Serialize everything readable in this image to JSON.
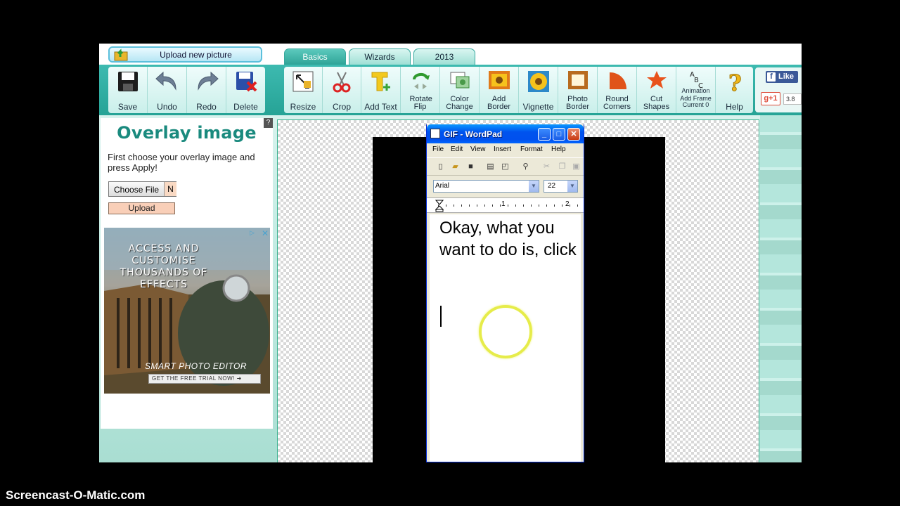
{
  "app": {
    "upload_new_picture": "Upload new picture",
    "tabs": [
      "Basics",
      "Wizards",
      "2013"
    ],
    "edit_tools": [
      "Save",
      "Undo",
      "Redo",
      "Delete"
    ],
    "tools": [
      {
        "label": "Resize",
        "icon": "resize-icon"
      },
      {
        "label": "Crop",
        "icon": "scissors-icon"
      },
      {
        "label": "Add Text",
        "icon": "text-t-icon"
      },
      {
        "label": "Rotate Flip",
        "icon": "rotate-icon"
      },
      {
        "label": "Color Change",
        "icon": "color-change-icon"
      },
      {
        "label": "Add Border",
        "icon": "sunflower-border-icon"
      },
      {
        "label": "Vignette",
        "icon": "sunflower-icon"
      },
      {
        "label": "Photo Border",
        "icon": "frame-icon"
      },
      {
        "label": "Round Corners",
        "icon": "round-corner-icon"
      },
      {
        "label": "Cut Shapes",
        "icon": "star-shape-icon"
      },
      {
        "label": "Animation",
        "icon": "abc-icon",
        "sub1": "Add Frame",
        "sub2": "Current 0"
      },
      {
        "label": "Help",
        "icon": "question-icon"
      }
    ],
    "social": {
      "like": "Like",
      "gplus": "g+1",
      "count": "3.8"
    }
  },
  "panel": {
    "title": "Overlay image",
    "help_mark": "?",
    "instructions": "First choose your overlay image and press Apply!",
    "choose_file": "Choose File",
    "choose_file_status": "N",
    "upload": "Upload"
  },
  "ad": {
    "headline": "ACCESS AND CUSTOMISE THOUSANDS OF EFFECTS",
    "brand": "SMART PHOTO EDITOR",
    "cta": "GET THE FREE TRIAL NOW! ➜"
  },
  "wordpad": {
    "title": "GIF - WordPad",
    "menu": [
      "File",
      "Edit",
      "View",
      "Insert",
      "Format",
      "Help"
    ],
    "font": "Arial",
    "size": "22",
    "ruler_marks": [
      "1",
      "2"
    ],
    "document_text": "Okay, what you want to do is, click"
  },
  "watermark": "Screencast-O-Matic.com",
  "colors": {
    "accent": "#2ea497",
    "title_green": "#1a8a7e",
    "xp_blue": "#0053ee"
  }
}
